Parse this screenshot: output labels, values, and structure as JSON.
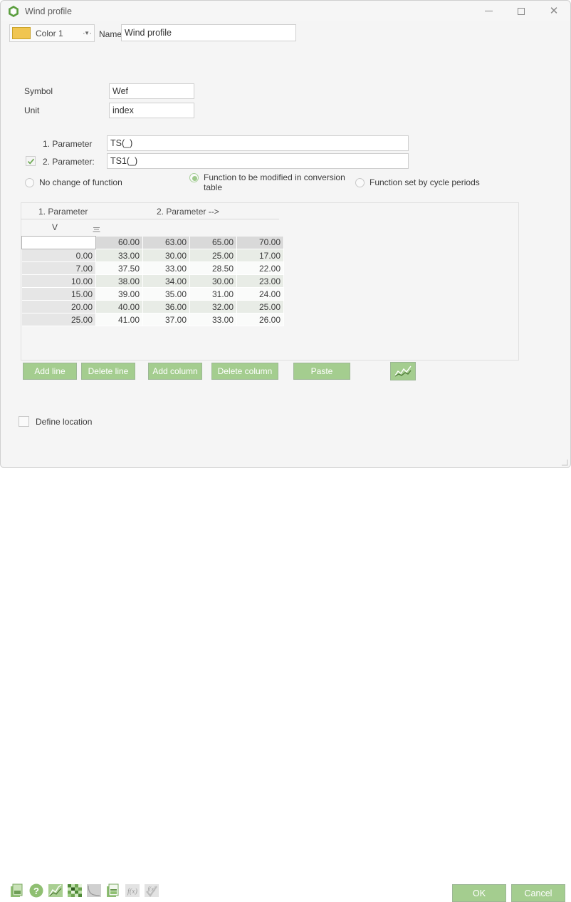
{
  "window": {
    "title": "Wind profile",
    "icon": "hexagon-ring-icon",
    "controls": {
      "minimize": "minimize-icon",
      "maximize": "maximize-icon",
      "close": "close-icon"
    }
  },
  "toolbar": {
    "color_label": "Color 1",
    "color_swatch_hex": "#f0c550",
    "dropdown_caret": "▼",
    "more_button": "···",
    "name_label": "Name:",
    "name_value": "Wind profile"
  },
  "fields": {
    "symbol_label": "Symbol",
    "symbol_value": "Wef",
    "unit_label": "Unit",
    "unit_value": "index",
    "param1_label": "1. Parameter",
    "param1_value": "TS(_)",
    "param2_label": "2. Parameter:",
    "param2_value": "TS1(_)",
    "param2_checked": true
  },
  "function_mode": {
    "options": [
      {
        "label": "No change of function",
        "selected": false
      },
      {
        "label": "Function to be modified in conversion table",
        "selected": true
      },
      {
        "label": "Function set by cycle periods",
        "selected": false
      }
    ]
  },
  "table": {
    "header_param1": "1. Parameter",
    "header_param2": "2. Parameter -->",
    "sub_symbol": "V",
    "sub_icon": "align-lines-icon",
    "column_headers": [
      "60.00",
      "63.00",
      "65.00",
      "70.00"
    ],
    "row_header_blank": "",
    "rows": [
      {
        "key": "0.00",
        "values": [
          "33.00",
          "30.00",
          "25.00",
          "17.00"
        ]
      },
      {
        "key": "7.00",
        "values": [
          "37.50",
          "33.00",
          "28.50",
          "22.00"
        ]
      },
      {
        "key": "10.00",
        "values": [
          "38.00",
          "34.00",
          "30.00",
          "23.00"
        ]
      },
      {
        "key": "15.00",
        "values": [
          "39.00",
          "35.00",
          "31.00",
          "24.00"
        ]
      },
      {
        "key": "20.00",
        "values": [
          "40.00",
          "36.00",
          "32.00",
          "25.00"
        ]
      },
      {
        "key": "25.00",
        "values": [
          "41.00",
          "37.00",
          "33.00",
          "26.00"
        ]
      }
    ]
  },
  "table_actions": {
    "add_line": "Add line",
    "delete_line": "Delete line",
    "add_column": "Add column",
    "delete_column": "Delete column",
    "paste": "Paste",
    "chart_button_icon": "line-chart-icon"
  },
  "define_location": {
    "label": "Define location",
    "checked": false
  },
  "status_icons": [
    "document-copy-icon",
    "help-question-icon",
    "line-chart-icon",
    "matrix-grid-icon",
    "curve-icon",
    "document-table-icon",
    "function-fx-icon",
    "function-fx-check-icon"
  ],
  "dialog_buttons": {
    "ok": "OK",
    "cancel": "Cancel"
  },
  "colors": {
    "accent_green": "#a4cd8f",
    "panel_bg": "#f5f5f5",
    "grid_alt_row": "#e8ece6",
    "grid_header": "#d9d9d9"
  }
}
